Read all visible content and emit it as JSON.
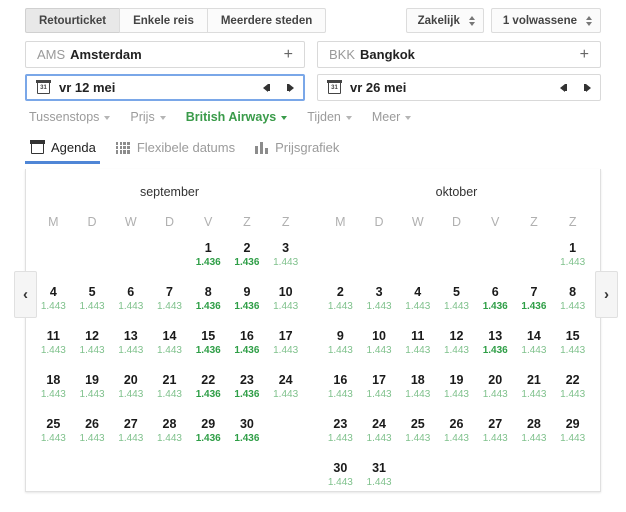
{
  "trip_types": [
    {
      "label": "Retourticket",
      "selected": true
    },
    {
      "label": "Enkele reis",
      "selected": false
    },
    {
      "label": "Meerdere steden",
      "selected": false
    }
  ],
  "selects": [
    {
      "name": "cabin-class",
      "value": "Zakelijk"
    },
    {
      "name": "passengers",
      "value": "1 volwassene"
    }
  ],
  "origin": {
    "code": "AMS",
    "city": "Amsterdam",
    "add": "+"
  },
  "destination": {
    "code": "BKK",
    "city": "Bangkok",
    "add": "+"
  },
  "depart_date": {
    "value": "vr 12 mei",
    "icon_day": "31"
  },
  "return_date": {
    "value": "vr 26 mei",
    "icon_day": "31"
  },
  "filters": [
    {
      "label": "Tussenstops",
      "active": false
    },
    {
      "label": "Prijs",
      "active": false
    },
    {
      "label": "British Airways",
      "active": true
    },
    {
      "label": "Tijden",
      "active": false
    },
    {
      "label": "Meer",
      "active": false
    }
  ],
  "tabs": [
    {
      "label": "Agenda",
      "icon": "calendar-icon",
      "active": true
    },
    {
      "label": "Flexibele datums",
      "icon": "grid-icon",
      "active": false
    },
    {
      "label": "Prijsgrafiek",
      "icon": "bar-chart-icon",
      "active": false
    }
  ],
  "nav": {
    "prev": "‹",
    "next": "›"
  },
  "weekday_headers": [
    "M",
    "D",
    "W",
    "D",
    "V",
    "Z",
    "Z"
  ],
  "price_colors": {
    "low": "#2e9e46",
    "normal": "#7fc18c"
  },
  "months": [
    {
      "name": "september",
      "lead_blanks": 4,
      "days": [
        {
          "day": "1",
          "price": "1.436",
          "low": true
        },
        {
          "day": "2",
          "price": "1.436",
          "low": true
        },
        {
          "day": "3",
          "price": "1.443",
          "low": false
        },
        {
          "day": "4",
          "price": "1.443",
          "low": false
        },
        {
          "day": "5",
          "price": "1.443",
          "low": false
        },
        {
          "day": "6",
          "price": "1.443",
          "low": false
        },
        {
          "day": "7",
          "price": "1.443",
          "low": false
        },
        {
          "day": "8",
          "price": "1.436",
          "low": true
        },
        {
          "day": "9",
          "price": "1.436",
          "low": true
        },
        {
          "day": "10",
          "price": "1.443",
          "low": false
        },
        {
          "day": "11",
          "price": "1.443",
          "low": false
        },
        {
          "day": "12",
          "price": "1.443",
          "low": false
        },
        {
          "day": "13",
          "price": "1.443",
          "low": false
        },
        {
          "day": "14",
          "price": "1.443",
          "low": false
        },
        {
          "day": "15",
          "price": "1.436",
          "low": true
        },
        {
          "day": "16",
          "price": "1.436",
          "low": true
        },
        {
          "day": "17",
          "price": "1.443",
          "low": false
        },
        {
          "day": "18",
          "price": "1.443",
          "low": false
        },
        {
          "day": "19",
          "price": "1.443",
          "low": false
        },
        {
          "day": "20",
          "price": "1.443",
          "low": false
        },
        {
          "day": "21",
          "price": "1.443",
          "low": false
        },
        {
          "day": "22",
          "price": "1.436",
          "low": true
        },
        {
          "day": "23",
          "price": "1.436",
          "low": true
        },
        {
          "day": "24",
          "price": "1.443",
          "low": false
        },
        {
          "day": "25",
          "price": "1.443",
          "low": false
        },
        {
          "day": "26",
          "price": "1.443",
          "low": false
        },
        {
          "day": "27",
          "price": "1.443",
          "low": false
        },
        {
          "day": "28",
          "price": "1.443",
          "low": false
        },
        {
          "day": "29",
          "price": "1.436",
          "low": true
        },
        {
          "day": "30",
          "price": "1.436",
          "low": true
        }
      ]
    },
    {
      "name": "oktober",
      "lead_blanks": 6,
      "days": [
        {
          "day": "1",
          "price": "1.443",
          "low": false
        },
        {
          "day": "2",
          "price": "1.443",
          "low": false
        },
        {
          "day": "3",
          "price": "1.443",
          "low": false
        },
        {
          "day": "4",
          "price": "1.443",
          "low": false
        },
        {
          "day": "5",
          "price": "1.443",
          "low": false
        },
        {
          "day": "6",
          "price": "1.436",
          "low": true
        },
        {
          "day": "7",
          "price": "1.436",
          "low": true
        },
        {
          "day": "8",
          "price": "1.443",
          "low": false
        },
        {
          "day": "9",
          "price": "1.443",
          "low": false
        },
        {
          "day": "10",
          "price": "1.443",
          "low": false
        },
        {
          "day": "11",
          "price": "1.443",
          "low": false
        },
        {
          "day": "12",
          "price": "1.443",
          "low": false
        },
        {
          "day": "13",
          "price": "1.436",
          "low": true
        },
        {
          "day": "14",
          "price": "1.443",
          "low": false
        },
        {
          "day": "15",
          "price": "1.443",
          "low": false
        },
        {
          "day": "16",
          "price": "1.443",
          "low": false
        },
        {
          "day": "17",
          "price": "1.443",
          "low": false
        },
        {
          "day": "18",
          "price": "1.443",
          "low": false
        },
        {
          "day": "19",
          "price": "1.443",
          "low": false
        },
        {
          "day": "20",
          "price": "1.443",
          "low": false
        },
        {
          "day": "21",
          "price": "1.443",
          "low": false
        },
        {
          "day": "22",
          "price": "1.443",
          "low": false
        },
        {
          "day": "23",
          "price": "1.443",
          "low": false
        },
        {
          "day": "24",
          "price": "1.443",
          "low": false
        },
        {
          "day": "25",
          "price": "1.443",
          "low": false
        },
        {
          "day": "26",
          "price": "1.443",
          "low": false
        },
        {
          "day": "27",
          "price": "1.443",
          "low": false
        },
        {
          "day": "28",
          "price": "1.443",
          "low": false
        },
        {
          "day": "29",
          "price": "1.443",
          "low": false
        },
        {
          "day": "30",
          "price": "1.443",
          "low": false
        },
        {
          "day": "31",
          "price": "1.443",
          "low": false
        }
      ]
    }
  ]
}
